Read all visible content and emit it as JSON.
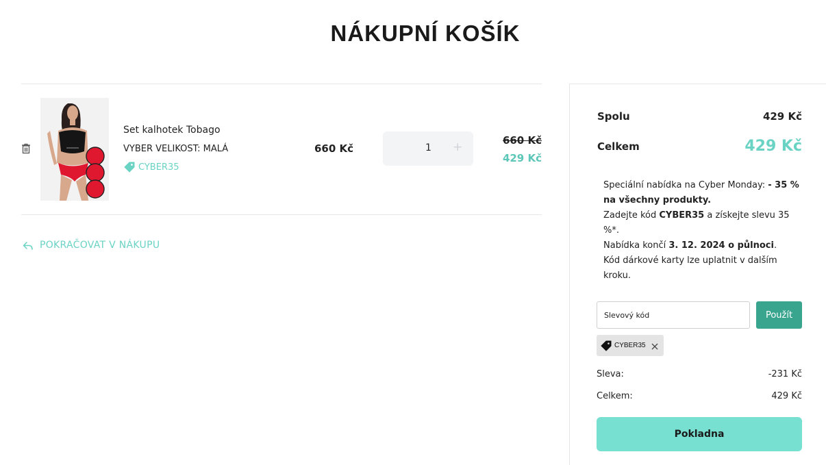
{
  "page": {
    "title": "NÁKUPNÍ KOŠÍK"
  },
  "cart": {
    "items": [
      {
        "name": "Set kalhotek Tobago",
        "variant": "VYBER VELIKOST: MALÁ",
        "coupon_tag": "CYBER35",
        "unit_price": "660 Kč",
        "quantity": "1",
        "quantity_plus": "+",
        "original_total": "660 Kč",
        "discounted_total": "429 Kč"
      }
    ],
    "continue_label": "POKRAČOVAT V NÁKUPU"
  },
  "summary": {
    "subtotal_label": "Spolu",
    "subtotal_value": "429 Kč",
    "total_label": "Celkem",
    "total_value": "429 Kč",
    "promo": {
      "line1": "Speciální nabídka na Cyber Monday: ",
      "line1_bold": "- 35 % na všechny produkty.",
      "line2_pre": "Zadejte kód ",
      "line2_code": "CYBER35",
      "line2_post": " a získejte slevu 35 %*.",
      "line3_pre": "Nabídka končí ",
      "line3_bold": "3. 12. 2024 o půlnoci",
      "line3_post": "."
    },
    "gift_note": "Kód dárkové karty lze uplatnit v dalším kroku.",
    "coupon_placeholder": "Slevový kód",
    "apply_label": "Použít",
    "applied_coupon": "CYBER35",
    "discount_label": "Sleva:",
    "discount_value": "-231 Kč",
    "final_label": "Celkem:",
    "final_value": "429 Kč",
    "checkout_label": "Pokladna"
  },
  "colors": {
    "accent": "#6ad3c4",
    "apply_button": "#3aa58e",
    "checkout_button": "#78e0d0"
  },
  "icons": {
    "delete": "trash-icon",
    "tag": "tag-icon",
    "continue": "reply-arrow-icon",
    "chip": "coupon-tag-icon",
    "remove": "close-icon"
  }
}
